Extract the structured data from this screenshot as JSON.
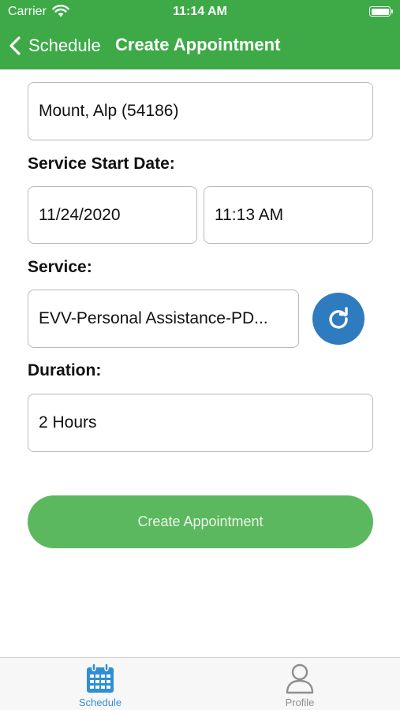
{
  "status_bar": {
    "carrier": "Carrier",
    "time": "11:14 AM"
  },
  "nav": {
    "back_label": "Schedule",
    "title": "Create Appointment"
  },
  "form": {
    "client_value": "Mount, Alp (54186)",
    "start_date_label": "Service Start Date:",
    "date_value": "11/24/2020",
    "time_value": "11:13 AM",
    "service_label": "Service:",
    "service_value": "EVV-Personal Assistance-PD...",
    "duration_label": "Duration:",
    "duration_value": "2 Hours"
  },
  "actions": {
    "create_label": "Create Appointment"
  },
  "tabs": [
    {
      "label": "Schedule",
      "icon": "calendar-icon",
      "selected": true
    },
    {
      "label": "Profile",
      "icon": "person-icon",
      "selected": false
    }
  ],
  "colors": {
    "header_green": "#3daa47",
    "button_green": "#5cb85f",
    "accent_blue": "#2f7bbf",
    "tab_active": "#2f8fd6"
  }
}
